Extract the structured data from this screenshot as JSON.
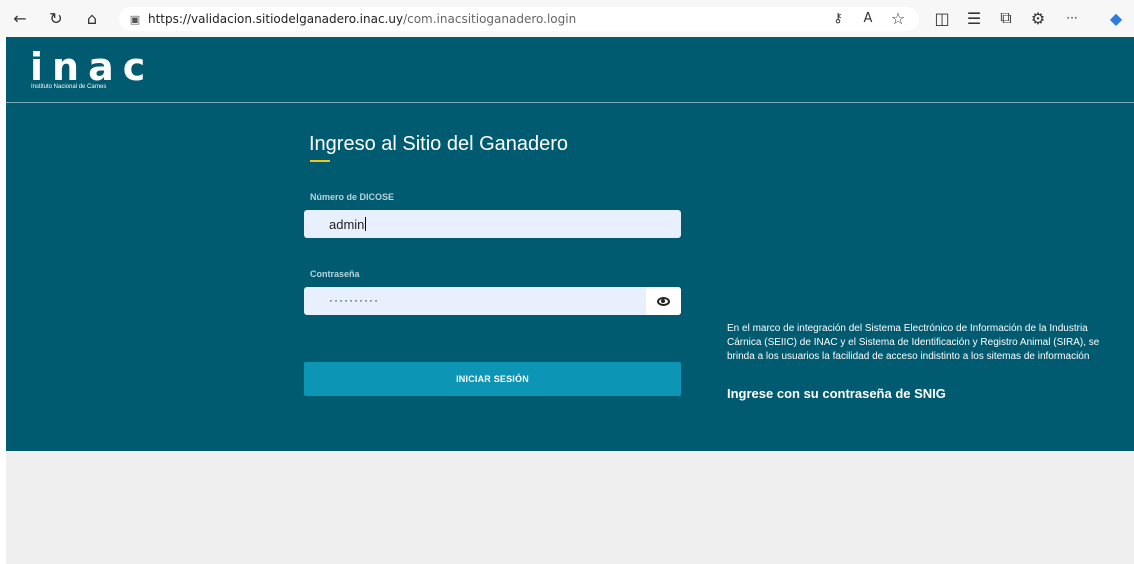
{
  "browser": {
    "url_host": "https://validacion.sitiodelganadero.inac.uy",
    "url_path": "/com.inacsitioganadero.login",
    "icons": [
      "back-icon",
      "refresh-icon",
      "home-icon",
      "site-info-icon",
      "password-key-icon",
      "read-aloud-icon",
      "favorite-icon",
      "split-screen-icon",
      "favorites-icon",
      "collections-icon",
      "extension-icon",
      "more-icon",
      "copilot-icon"
    ],
    "glyphs": {
      "back": "←",
      "refresh": "↻",
      "home": "⌂",
      "lock": "🔒",
      "key": "⚷",
      "read": "A",
      "fav": "☆",
      "split": "◫",
      "favs": "☰",
      "collections": "⧉",
      "ext": "⚙",
      "more": "···",
      "copilot": "◆"
    }
  },
  "header": {
    "logo_text": "inac",
    "logo_subtitle": "Instituto Nacional de Carnes"
  },
  "login": {
    "title": "Ingreso al Sitio del Ganadero",
    "user_label": "Número de DICOSE",
    "user_value": "admin",
    "password_label": "Contraseña",
    "password_mask": "··········",
    "submit_label": "INICIAR SESIÓN"
  },
  "info": {
    "text": "En el marco de integración del Sistema Electrónico de Información de la Industria Cárnica (SEIIC) de INAC y el Sistema de Identificación y Registro Animal (SIRA), se brinda a los usuarios la facilidad de acceso indistinto a los sitemas de información",
    "cta": "Ingrese con su contraseña de SNIG"
  },
  "colors": {
    "brand": "#005a70",
    "button": "#0d95b5",
    "accent": "#f5c518"
  }
}
